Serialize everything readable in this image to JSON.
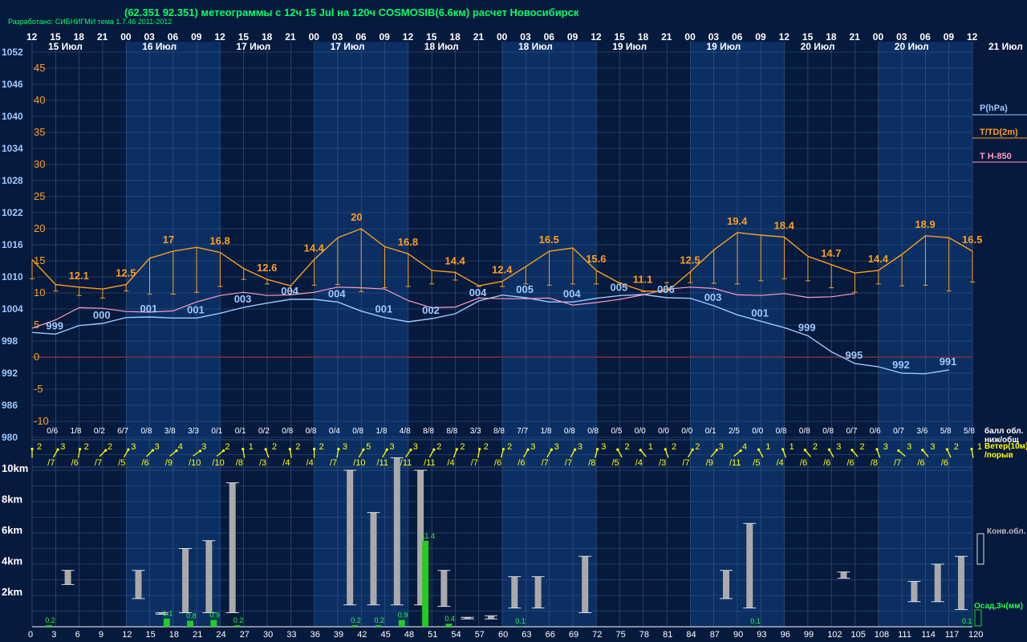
{
  "header": {
    "title": "(62.351 92.351) метеограммы с  12ч 15 Jul на 120ч COSMOSIB(6.6км) расчет Новосибирск",
    "credit": "Разработано: СИБНИГМИ тема 1.7.46 2011-2012"
  },
  "colors": {
    "background": "#061a3d",
    "day_band": "#0b2f63",
    "grid": "#3b5a86",
    "pressure": "#9cc8ff",
    "temperature": "#ff9e1b",
    "t850": "#ff9ec0",
    "wind": "#ffff00",
    "convective": "#aaaaaa",
    "precip": "#22cc22",
    "precip_label": "#22ff44",
    "zero_line": "#993333",
    "text": "#ffffff"
  },
  "chart_data": {
    "type": "line",
    "time_hours": [
      "12",
      "15",
      "18",
      "21",
      "00",
      "03",
      "06",
      "09",
      "12",
      "15",
      "18",
      "21",
      "00",
      "03",
      "06",
      "09",
      "12",
      "15",
      "18",
      "21",
      "00",
      "03",
      "06",
      "09",
      "12",
      "15",
      "18",
      "21",
      "00",
      "03",
      "06",
      "09",
      "12",
      "15",
      "18",
      "21",
      "00",
      "03",
      "06",
      "09",
      "12"
    ],
    "date_labels": [
      "15 Июл",
      "16 Июл",
      "17 Июл",
      "17 Июл",
      "18 Июл",
      "18 Июл",
      "19 Июл",
      "19 Июл",
      "20 Июл",
      "20 Июл",
      "21 Июл"
    ],
    "pressure_axis": [
      "1052",
      "1046",
      "1040",
      "1034",
      "1028",
      "1022",
      "1016",
      "1010",
      "1004",
      "998",
      "992",
      "986",
      "980"
    ],
    "temp_axis": [
      "45",
      "40",
      "35",
      "30",
      "25",
      "20",
      "15",
      "10",
      "5",
      "0",
      "-5",
      "-10"
    ],
    "legend": {
      "pressure": "P(hPa)",
      "temperature": "T/TD(2m)",
      "t850": "T H-850",
      "clouds": "балл обл.\nниж/общ",
      "wind": "Ветер(10м)\n/порыв",
      "convective": "Конв.обл.",
      "precip": "Осад,3ч(мм)"
    },
    "pressure_series": [
      999.6,
      999.3,
      1000.9,
      1001.3,
      1002.4,
      1002.5,
      1002.3,
      1002.3,
      1003.2,
      1004.3,
      1005.1,
      1005.8,
      1005.8,
      1005.3,
      1003.6,
      1002.4,
      1001.6,
      1002.2,
      1003.1,
      1005.5,
      1006.6,
      1006.1,
      1005.3,
      1005.3,
      1006.0,
      1006.5,
      1006.7,
      1006.1,
      1006.0,
      1004.6,
      1002.9,
      1001.7,
      1000.5,
      999.0,
      996.0,
      993.8,
      993.2,
      992.0,
      991.9,
      992.6
    ],
    "pressure_labels": [
      "999",
      "000",
      "001",
      "001",
      "003",
      "004",
      "004",
      "001",
      "002",
      "004",
      "005",
      "004",
      "005",
      "006",
      "003",
      "001",
      "999",
      "995",
      "992",
      "991"
    ],
    "t850_series": [
      4.5,
      5.8,
      7.7,
      7.6,
      7.1,
      7.0,
      7.2,
      8.6,
      9.6,
      10.1,
      9.6,
      9.7,
      10.1,
      10.9,
      10.8,
      10.6,
      8.8,
      7.7,
      7.8,
      9.2,
      9.1,
      9.1,
      9.2,
      8.1,
      8.5,
      9.0,
      9.7,
      10.6,
      10.9,
      10.7,
      9.7,
      9.6,
      9.9,
      9.3,
      9.4,
      9.9
    ],
    "temp_series": [
      15.2,
      11.3,
      10.9,
      10.6,
      11.3,
      15.4,
      16.5,
      17.1,
      16.3,
      13.8,
      12.1,
      11.1,
      15.2,
      18.6,
      20.0,
      17.2,
      16.1,
      13.5,
      13.2,
      11.1,
      11.8,
      14.1,
      16.5,
      17.0,
      13.5,
      11.5,
      10.3,
      10.2,
      13.3,
      16.7,
      19.4,
      19.0,
      18.7,
      15.7,
      14.4,
      13.1,
      13.5,
      16.0,
      18.9,
      18.6,
      16.5
    ],
    "dew_series": [
      12.2,
      10.3,
      9.6,
      9.2,
      10.3,
      9.8,
      9.8,
      10.1,
      11.0,
      12.1,
      11.4,
      10.3,
      11.2,
      11.3,
      10.2,
      10.8,
      11.0,
      11.4,
      12.0,
      11.0,
      11.0,
      11.4,
      11.2,
      11.4,
      11.4,
      11.6,
      10.2,
      11.6,
      11.6,
      11.5,
      11.4,
      11.9,
      12.2,
      11.9,
      10.8,
      10.1,
      11.4,
      11.1,
      11.2,
      10.3,
      11.7
    ],
    "temp_labels": [
      "12.1",
      "12.5",
      "17",
      "16.8",
      "12.6",
      "14.4",
      "20",
      "16.8",
      "14.4",
      "12.4",
      "16.5",
      "15.6",
      "11.1",
      "12.5",
      "19.4",
      "18.4",
      "14.7",
      "14.4",
      "18.9",
      "16.5"
    ],
    "cloud_labels": [
      "0/6",
      "1/8",
      "0/2",
      "6/7",
      "0/8",
      "3/8",
      "3/3",
      "0/1",
      "0/1",
      "0/2",
      "0/8",
      "0/8",
      "0/4",
      "0/8",
      "1/8",
      "4/8",
      "8/8",
      "8/8",
      "3/3",
      "8/8",
      "7/7",
      "1/8",
      "0/8",
      "0/8",
      "0/5",
      "0/0",
      "0/0",
      "0/0",
      "0/1",
      "2/5",
      "0/0",
      "0/8",
      "0/8",
      "0/8",
      "0/7",
      "0/6",
      "0/7",
      "3/6",
      "5/8",
      "5/8"
    ],
    "wind_speed": [
      "2",
      "3",
      "2",
      "2",
      "3",
      "3",
      "4",
      "3",
      "2",
      "1",
      "2",
      "2",
      "2",
      "3",
      "5",
      "3",
      "3",
      "2",
      "2",
      "2",
      "2",
      "3",
      "3",
      "3",
      "3",
      "2",
      "1",
      "2",
      "2",
      "3",
      "4",
      "1",
      "1",
      "2",
      "3",
      "2",
      "3",
      "3",
      "3",
      "2",
      "1"
    ],
    "wind_gust": [
      "/7",
      "/6",
      "/7",
      "/5",
      "/6",
      "/9",
      "/10",
      "/10",
      "/8",
      "/3",
      "/4",
      "/4",
      "/7",
      "/10",
      "/11",
      "/11",
      "/11",
      "/4",
      "/7",
      "/6",
      "/6",
      "/7",
      "/7",
      "/8",
      "/5",
      "/4",
      "/3",
      "/7",
      "/9",
      "/11",
      "/5",
      "/4",
      "/6",
      "/6",
      "/6",
      "/8",
      "/7",
      "/6",
      "/6"
    ],
    "height_axis": [
      "10km",
      "8km",
      "6km",
      "4km",
      "2km"
    ],
    "convective_clouds": [
      {
        "h": 6,
        "top": 3.6,
        "base": 2.7
      },
      {
        "h": 15,
        "top": 3.6,
        "base": 1.8
      },
      {
        "h": 18,
        "top": 0.9,
        "base": 0.8
      },
      {
        "h": 21,
        "top": 5.0,
        "base": 0.9
      },
      {
        "h": 24,
        "top": 5.5,
        "base": 0.9
      },
      {
        "h": 27,
        "top": 9.2,
        "base": 0.9
      },
      {
        "h": 42,
        "top": 10.0,
        "base": 1.4
      },
      {
        "h": 45,
        "top": 7.3,
        "base": 1.4
      },
      {
        "h": 48,
        "top": 10.8,
        "base": 1.4
      },
      {
        "h": 51,
        "top": 10.0,
        "base": 1.4
      },
      {
        "h": 54,
        "top": 3.6,
        "base": 1.3
      },
      {
        "h": 57,
        "top": 0.6,
        "base": 0.5
      },
      {
        "h": 60,
        "top": 0.7,
        "base": 0.5
      },
      {
        "h": 63,
        "top": 3.2,
        "base": 1.2
      },
      {
        "h": 66,
        "top": 3.2,
        "base": 1.2
      },
      {
        "h": 72,
        "top": 4.5,
        "base": 0.9
      },
      {
        "h": 90,
        "top": 3.6,
        "base": 1.8
      },
      {
        "h": 93,
        "top": 6.6,
        "base": 1.2
      },
      {
        "h": 105,
        "top": 3.5,
        "base": 3.1
      },
      {
        "h": 114,
        "top": 2.9,
        "base": 1.6
      },
      {
        "h": 117,
        "top": 4.0,
        "base": 1.6
      },
      {
        "h": 120,
        "top": 4.5,
        "base": 1.1
      }
    ],
    "precip": [
      {
        "h": 3,
        "v": 0.2
      },
      {
        "h": 18,
        "v": 1.1
      },
      {
        "h": 21,
        "v": 0.8
      },
      {
        "h": 24,
        "v": 0.9
      },
      {
        "h": 27,
        "v": 0.2
      },
      {
        "h": 42,
        "v": 0.2
      },
      {
        "h": 45,
        "v": 0.2
      },
      {
        "h": 48,
        "v": 0.9
      },
      {
        "h": 51,
        "v": 11.4
      },
      {
        "h": 54,
        "v": 0.4
      },
      {
        "h": 63,
        "v": 0.1
      },
      {
        "h": 93,
        "v": 0.1
      },
      {
        "h": 120,
        "v": 0.1
      }
    ],
    "lead_hours": [
      "0",
      "3",
      "6",
      "9",
      "12",
      "15",
      "18",
      "21",
      "24",
      "27",
      "30",
      "33",
      "36",
      "39",
      "42",
      "45",
      "48",
      "51",
      "54",
      "57",
      "60",
      "63",
      "66",
      "69",
      "72",
      "75",
      "78",
      "81",
      "84",
      "87",
      "90",
      "93",
      "96",
      "99",
      "102",
      "105",
      "108",
      "111",
      "114",
      "117",
      "120"
    ]
  }
}
